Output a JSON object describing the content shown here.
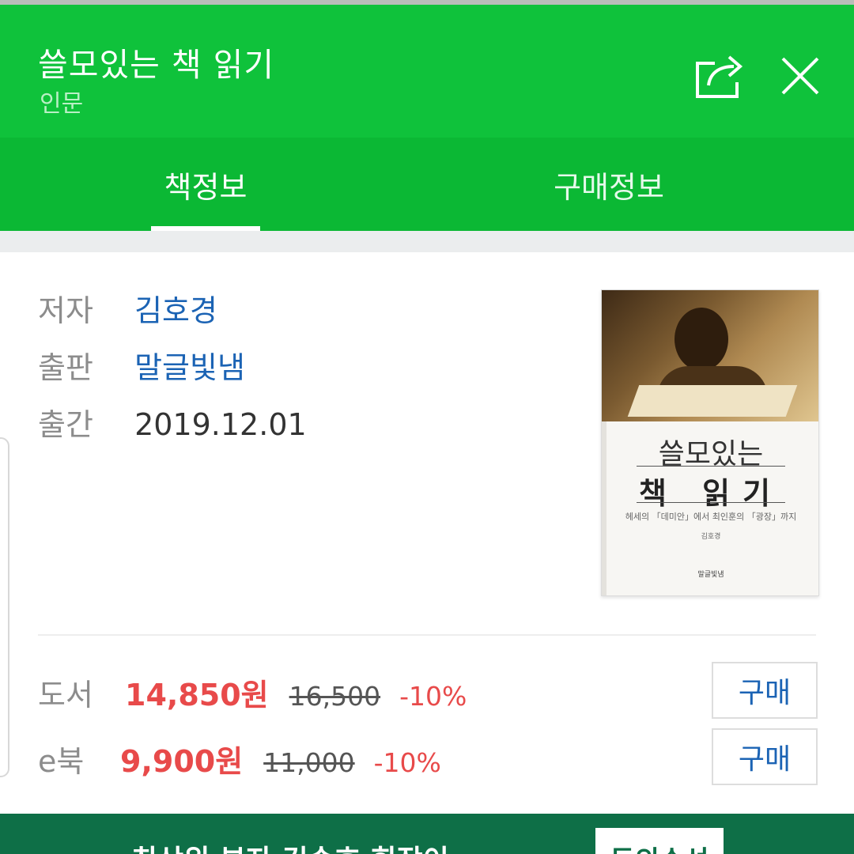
{
  "header": {
    "title": "쓸모있는 책 읽기",
    "category": "인문",
    "share_icon": "share-icon",
    "close_icon": "close-icon"
  },
  "tabs": [
    {
      "label": "책정보",
      "active": true
    },
    {
      "label": "구매정보",
      "active": false
    }
  ],
  "book_info": {
    "author_label": "저자",
    "author": "김호경",
    "publisher_label": "출판",
    "publisher": "말글빛냄",
    "date_label": "출간",
    "date": "2019.12.01"
  },
  "cover": {
    "title_line1": "쓸모있는",
    "title_line2": "책 읽기",
    "subtitle": "헤세의 「데미안」에서 최인훈의 「광장」까지",
    "author": "김호경",
    "publisher": "말글빛냄"
  },
  "prices": [
    {
      "label": "도서",
      "sale": "14,850원",
      "original": "16,500",
      "discount": "-10%",
      "button": "구매"
    },
    {
      "label": "e북",
      "sale": "9,900원",
      "original": "11,000",
      "discount": "-10%",
      "button": "구매"
    }
  ],
  "banner": {
    "text": "최상위 부자 김승호 회장이",
    "badge": "동의수선"
  },
  "colors": {
    "header_green": "#0fc23b",
    "tab_green": "#0bb834",
    "link_blue": "#1b63b4",
    "price_red": "#e84a4a",
    "banner_green": "#0e6f47"
  }
}
